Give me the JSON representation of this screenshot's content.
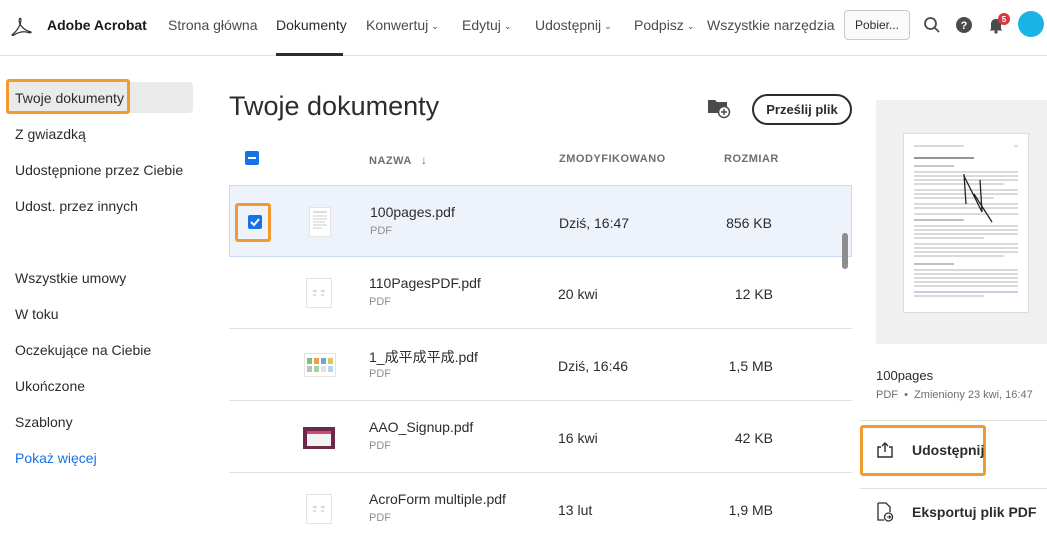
{
  "app": {
    "brand": "Adobe Acrobat"
  },
  "nav": {
    "home": "Strona główna",
    "documents": "Dokumenty",
    "convert": "Konwertuj",
    "edit": "Edytuj",
    "share": "Udostępnij",
    "sign": "Podpisz",
    "all_tools": "Wszystkie narzędzia",
    "download": "Pobier...",
    "notifications_count": "5"
  },
  "sidebar": {
    "items": [
      "Twoje dokumenty",
      "Z gwiazdką",
      "Udostępnione przez Ciebie",
      "Udost. przez innych"
    ],
    "agreements": [
      "Wszystkie umowy",
      "W toku",
      "Oczekujące na Ciebie",
      "Ukończone",
      "Szablony"
    ],
    "show_more": "Pokaż więcej"
  },
  "main": {
    "title": "Twoje dokumenty",
    "upload": "Prześlij plik",
    "columns": {
      "name": "NAZWA",
      "modified": "ZMODYFIKOWANO",
      "size": "ROZMIAR"
    },
    "files": [
      {
        "name": "100pages.pdf",
        "type": "PDF",
        "modified": "Dziś, 16:47",
        "size": "856 KB",
        "selected": true
      },
      {
        "name": "110PagesPDF.pdf",
        "type": "PDF",
        "modified": "20 kwi",
        "size": "12 KB",
        "selected": false
      },
      {
        "name": "1_成平成平成.pdf",
        "type": "PDF",
        "modified": "Dziś, 16:46",
        "size": "1,5 MB",
        "selected": false
      },
      {
        "name": "AAO_Signup.pdf",
        "type": "PDF",
        "modified": "16 kwi",
        "size": "42 KB",
        "selected": false
      },
      {
        "name": "AcroForm multiple.pdf",
        "type": "PDF",
        "modified": "13 lut",
        "size": "1,9 MB",
        "selected": false
      }
    ]
  },
  "panel": {
    "file_title": "100pages",
    "file_type": "PDF",
    "modified": "Zmieniony 23 kwi, 16:47",
    "share": "Udostępnij",
    "export": "Eksportuj plik PDF"
  },
  "colors": {
    "accent": "#1473e6",
    "highlight": "#f09a2f",
    "badge": "#d7373f",
    "avatar": "#1ab3e6"
  }
}
